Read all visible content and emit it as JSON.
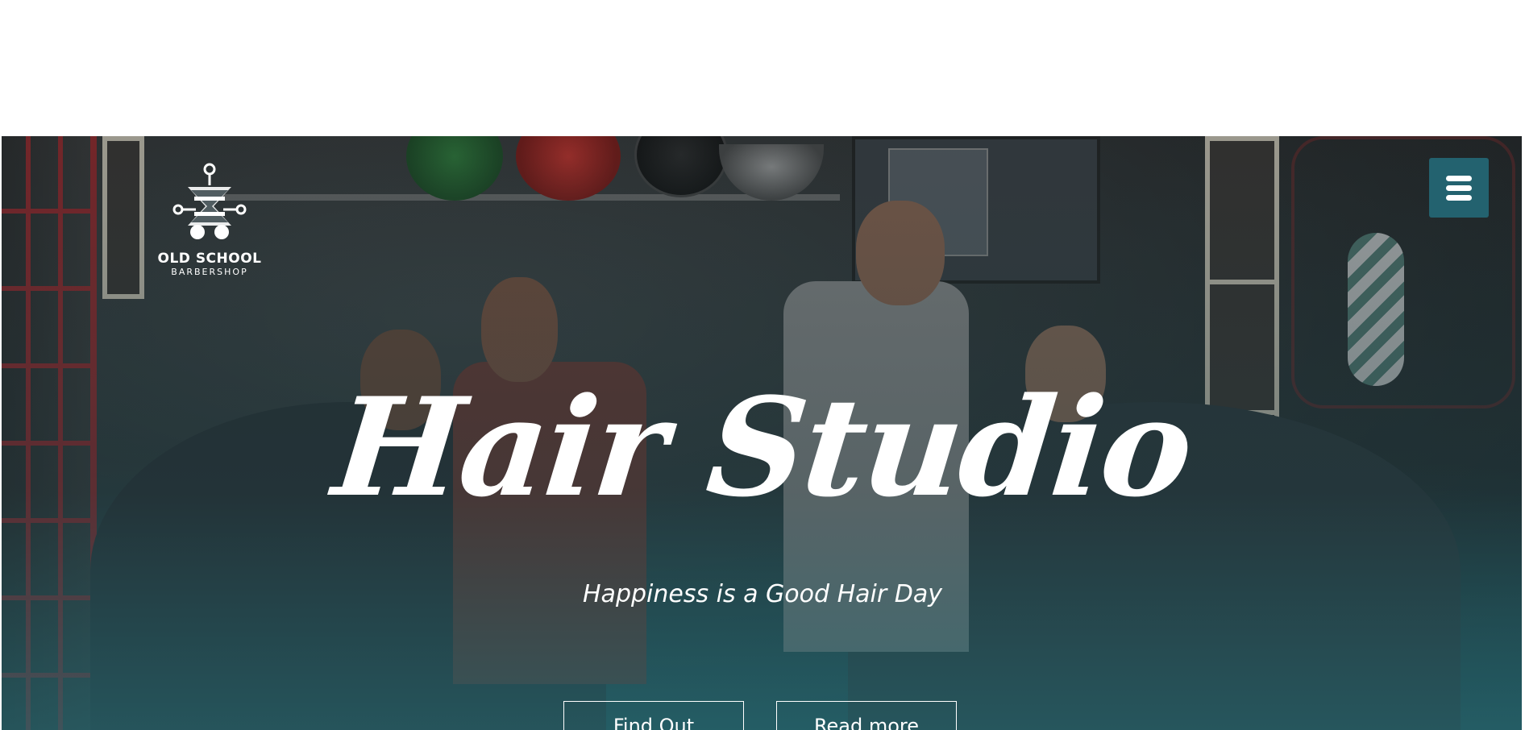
{
  "brand": {
    "name": "OLD SCHOOL",
    "tagline": "BARBERSHOP"
  },
  "hero": {
    "title": "Hair Studio",
    "subtitle": "Happiness is a Good Hair Day",
    "buttons": [
      {
        "label": "Find Out"
      },
      {
        "label": "Read more"
      }
    ]
  },
  "menu": {
    "icon": "hamburger-menu-icon"
  },
  "colors": {
    "accent": "#23626f",
    "text_on_hero": "#ffffff",
    "background": "#ffffff"
  }
}
